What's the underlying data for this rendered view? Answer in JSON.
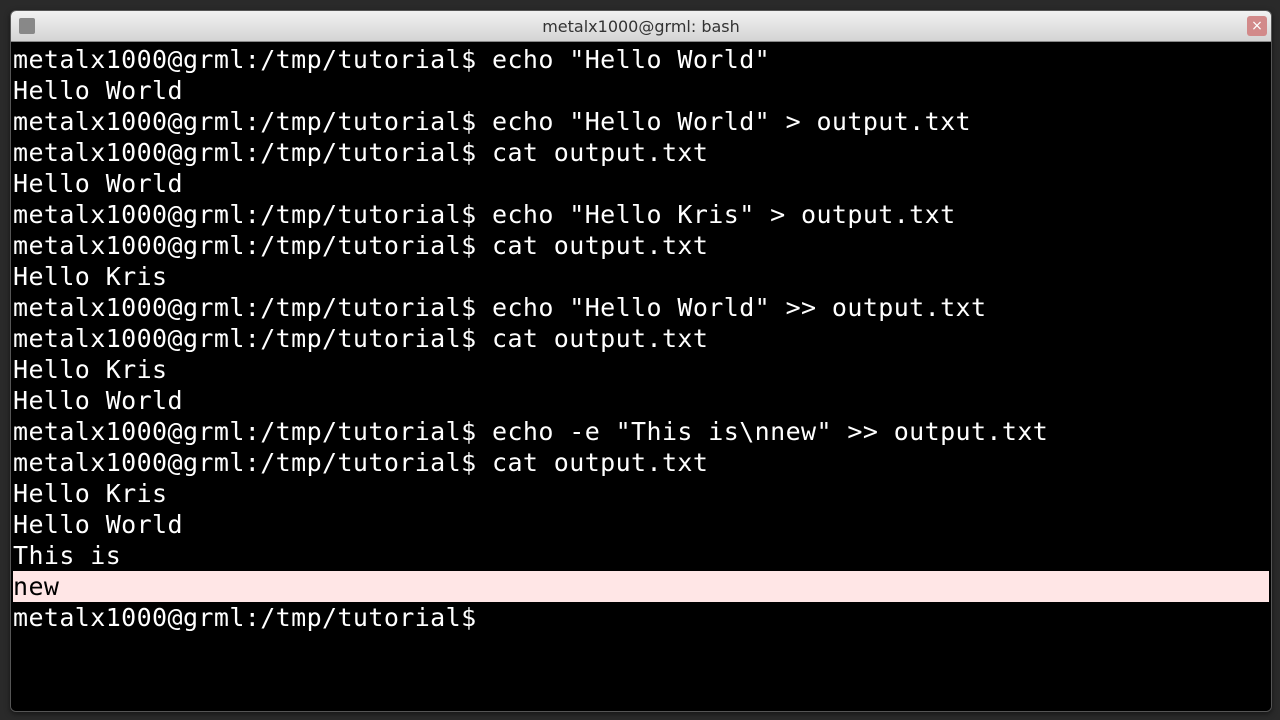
{
  "title": "metalx1000@grml: bash",
  "prompt": "metalx1000@grml:/tmp/tutorial$",
  "lines": [
    {
      "type": "cmd",
      "cmd": "echo \"Hello World\""
    },
    {
      "type": "out",
      "text": "Hello World"
    },
    {
      "type": "cmd",
      "cmd": "echo \"Hello World\" > output.txt"
    },
    {
      "type": "cmd",
      "cmd": "cat output.txt"
    },
    {
      "type": "out",
      "text": "Hello World"
    },
    {
      "type": "cmd",
      "cmd": "echo \"Hello Kris\" > output.txt"
    },
    {
      "type": "cmd",
      "cmd": "cat output.txt"
    },
    {
      "type": "out",
      "text": "Hello Kris"
    },
    {
      "type": "cmd",
      "cmd": "echo \"Hello World\" >> output.txt"
    },
    {
      "type": "cmd",
      "cmd": "cat output.txt"
    },
    {
      "type": "out",
      "text": "Hello Kris"
    },
    {
      "type": "out",
      "text": "Hello World"
    },
    {
      "type": "cmd",
      "cmd": "echo -e \"This is\\nnew\" >> output.txt"
    },
    {
      "type": "cmd",
      "cmd": "cat output.txt"
    },
    {
      "type": "out",
      "text": "Hello Kris"
    },
    {
      "type": "out",
      "text": "Hello World"
    },
    {
      "type": "out",
      "text": "This is"
    },
    {
      "type": "out",
      "text": "new",
      "highlight": true
    },
    {
      "type": "cmd",
      "cmd": ""
    }
  ]
}
